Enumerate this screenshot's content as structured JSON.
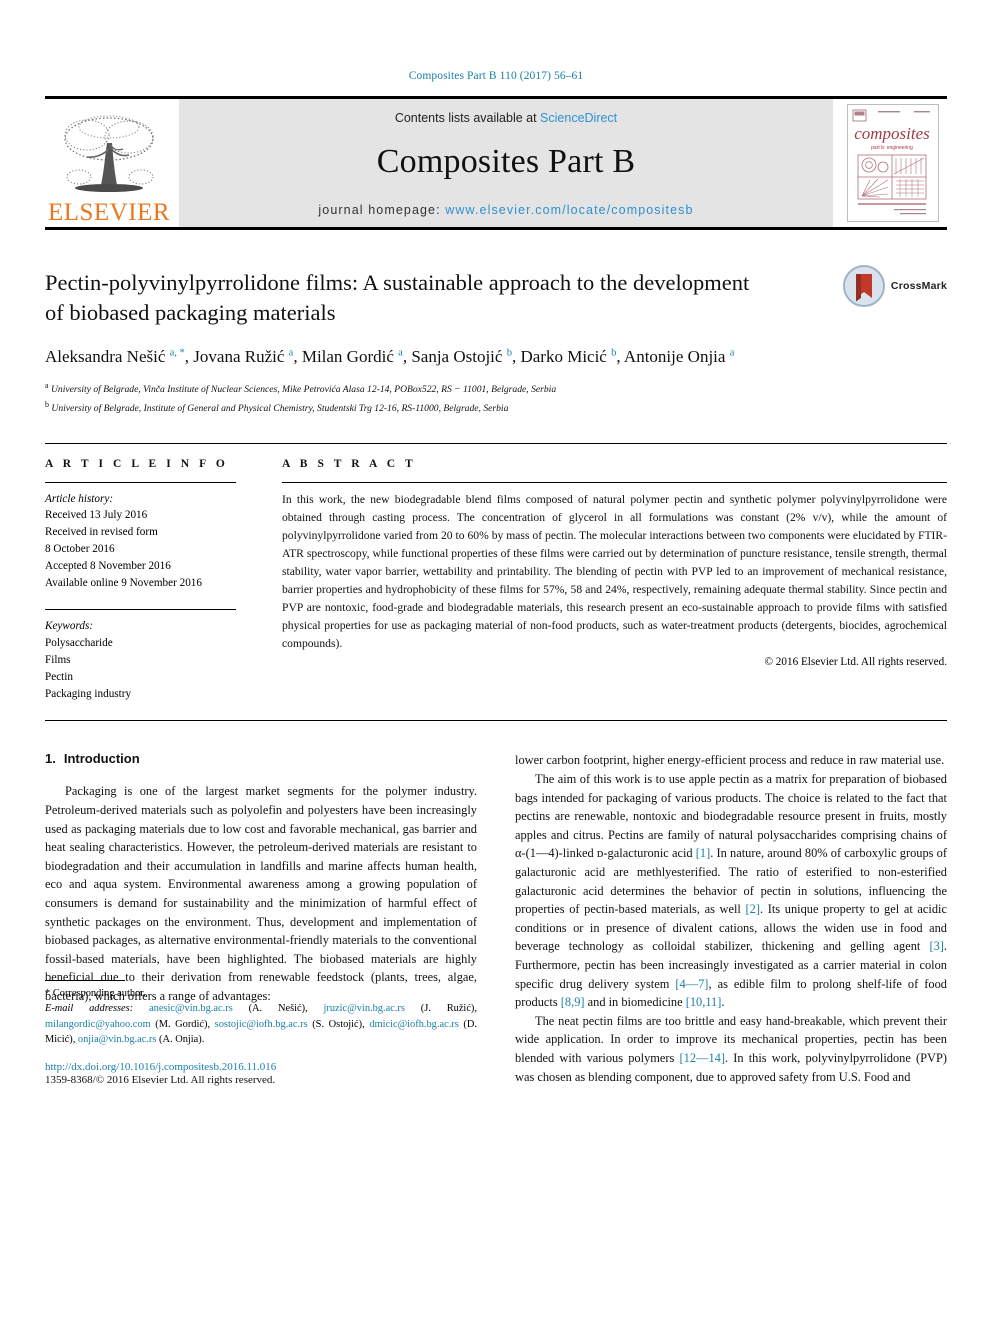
{
  "running_head": "Composites Part B 110 (2017) 56–61",
  "masthead": {
    "publisher_logo_text": "ELSEVIER",
    "contents_prefix": "Contents lists available at ",
    "contents_link": "ScienceDirect",
    "journal_name": "Composites Part B",
    "homepage_label": "journal homepage: ",
    "homepage_url": "www.elsevier.com/locate/compositesb",
    "cover_title": "composites",
    "cover_subtitle": "part b: engineering"
  },
  "article": {
    "title": "Pectin-polyvinylpyrrolidone films: A sustainable approach to the development of biobased packaging materials",
    "authors_html": "Aleksandra Nešić <sup>a, *</sup>, Jovana Ružić <sup>a</sup>, Milan Gordić <sup>a</sup>, Sanja Ostojić <sup>b</sup>, Darko Micić <sup>b</sup>, Antonije Onjia <sup>a</sup>",
    "affiliations": [
      "University of Belgrade, Vinča Institute of Nuclear Sciences, Mike Petrovića Alasa 12-14, POBox522, RS − 11001, Belgrade, Serbia",
      "University of Belgrade, Institute of General and Physical Chemistry, Studentski Trg 12-16, RS-11000, Belgrade, Serbia"
    ],
    "affiliation_marks": [
      "a",
      "b"
    ],
    "crossmark_label": "CrossMark"
  },
  "article_info": {
    "heading": "A R T I C L E  I N F O",
    "history_label": "Article history:",
    "history": [
      "Received 13 July 2016",
      "Received in revised form",
      "8 October 2016",
      "Accepted 8 November 2016",
      "Available online 9 November 2016"
    ],
    "keywords_label": "Keywords:",
    "keywords": [
      "Polysaccharide",
      "Films",
      "Pectin",
      "Packaging industry"
    ]
  },
  "abstract": {
    "heading": "A B S T R A C T",
    "text": "In this work, the new biodegradable blend films composed of natural polymer pectin and synthetic polymer polyvinylpyrrolidone were obtained through casting process. The concentration of glycerol in all formulations was constant (2% v/v), while the amount of polyvinylpyrrolidone varied from 20 to 60% by mass of pectin. The molecular interactions between two components were elucidated by FTIR-ATR spectroscopy, while functional properties of these films were carried out by determination of puncture resistance, tensile strength, thermal stability, water vapor barrier, wettability and printability. The blending of pectin with PVP led to an improvement of mechanical resistance, barrier properties and hydrophobicity of these films for 57%, 58 and 24%, respectively, remaining adequate thermal stability. Since pectin and PVP are nontoxic, food-grade and biodegradable materials, this research present an eco-sustainable approach to provide films with satisfied physical properties for use as packaging material of non-food products, such as water-treatment products (detergents, biocides, agrochemical compounds).",
    "copyright": "© 2016 Elsevier Ltd. All rights reserved."
  },
  "introduction": {
    "number": "1.",
    "heading": "Introduction",
    "left_paragraphs": [
      "Packaging is one of the largest market segments for the polymer industry. Petroleum-derived materials such as polyolefin and polyesters have been increasingly used as packaging materials due to low cost and favorable mechanical, gas barrier and heat sealing characteristics. However, the petroleum-derived materials are resistant to biodegradation and their accumulation in landfills and marine affects human health, eco and aqua system. Environmental awareness among a growing population of consumers is demand for sustainability and the minimization of harmful effect of synthetic packages on the environment. Thus, development and implementation of biobased packages, as alternative environmental-friendly materials to the conventional fossil-based materials, have been highlighted. The biobased materials are highly beneficial due to their derivation from renewable feedstock (plants, trees, algae, bacteria), which offers a range of advantages:"
    ],
    "right_paragraphs": [
      {
        "indent": false,
        "parts": [
          {
            "t": "lower carbon footprint, higher energy-efficient process and reduce in raw material use."
          }
        ]
      },
      {
        "indent": true,
        "parts": [
          {
            "t": "The aim of this work is to use apple pectin as a matrix for preparation of biobased bags intended for packaging of various products. The choice is related to the fact that pectins are renewable, nontoxic and biodegradable resource present in fruits, mostly apples and citrus. Pectins are family of natural polysaccharides comprising chains of α-(1—4)-linked ᴅ-galacturonic acid "
          },
          {
            "t": "[1]",
            "ref": true
          },
          {
            "t": ". In nature, around 80% of carboxylic groups of galacturonic acid are methlyesterified. The ratio of esterified to non-esterified galacturonic acid determines the behavior of pectin in solutions, influencing the properties of pectin-based materials, as well "
          },
          {
            "t": "[2]",
            "ref": true
          },
          {
            "t": ". Its unique property to gel at acidic conditions or in presence of divalent cations, allows the widen use in food and beverage technology as colloidal stabilizer, thickening and gelling agent "
          },
          {
            "t": "[3]",
            "ref": true
          },
          {
            "t": ". Furthermore, pectin has been increasingly investigated as a carrier material in colon specific drug delivery system "
          },
          {
            "t": "[4—7]",
            "ref": true
          },
          {
            "t": ", as edible film to prolong shelf-life of food products "
          },
          {
            "t": "[8,9]",
            "ref": true
          },
          {
            "t": " and in biomedicine "
          },
          {
            "t": "[10,11]",
            "ref": true
          },
          {
            "t": "."
          }
        ]
      },
      {
        "indent": true,
        "parts": [
          {
            "t": "The neat pectin films are too brittle and easy hand-breakable, which prevent their wide application. In order to improve its mechanical properties, pectin has been blended with various polymers "
          },
          {
            "t": "[12—14]",
            "ref": true
          },
          {
            "t": ". In this work, polyvinylpyrrolidone (PVP) was chosen as blending component, due to approved safety from U.S. Food and"
          }
        ]
      }
    ]
  },
  "footnote": {
    "corresponding_star": "*",
    "corresponding_text": "Corresponding author.",
    "email_label": "E-mail addresses:",
    "emails": [
      {
        "address": "anesic@vin.bg.ac.rs",
        "name": "(A. Nešić)"
      },
      {
        "address": "jruzic@vin.bg.ac.rs",
        "name": "(J. Ružić)"
      },
      {
        "address": "milangordic@yahoo.com",
        "name": "(M. Gordić)"
      },
      {
        "address": "sostojic@iofh.bg.ac.rs",
        "name": "(S. Ostojić)"
      },
      {
        "address": "dmicic@iofh.bg.ac.rs",
        "name": "(D. Micić)"
      },
      {
        "address": "onjia@vin.bg.ac.rs",
        "name": "(A. Onjia)"
      }
    ],
    "doi": "http://dx.doi.org/10.1016/j.compositesb.2016.11.016",
    "issn": "1359-8368/© 2016 Elsevier Ltd. All rights reserved."
  },
  "colors": {
    "link": "#1a7fa8",
    "science_direct": "#2f8fd0",
    "elsevier_orange": "#E87722",
    "masthead_bg": "#e4e4e4"
  }
}
